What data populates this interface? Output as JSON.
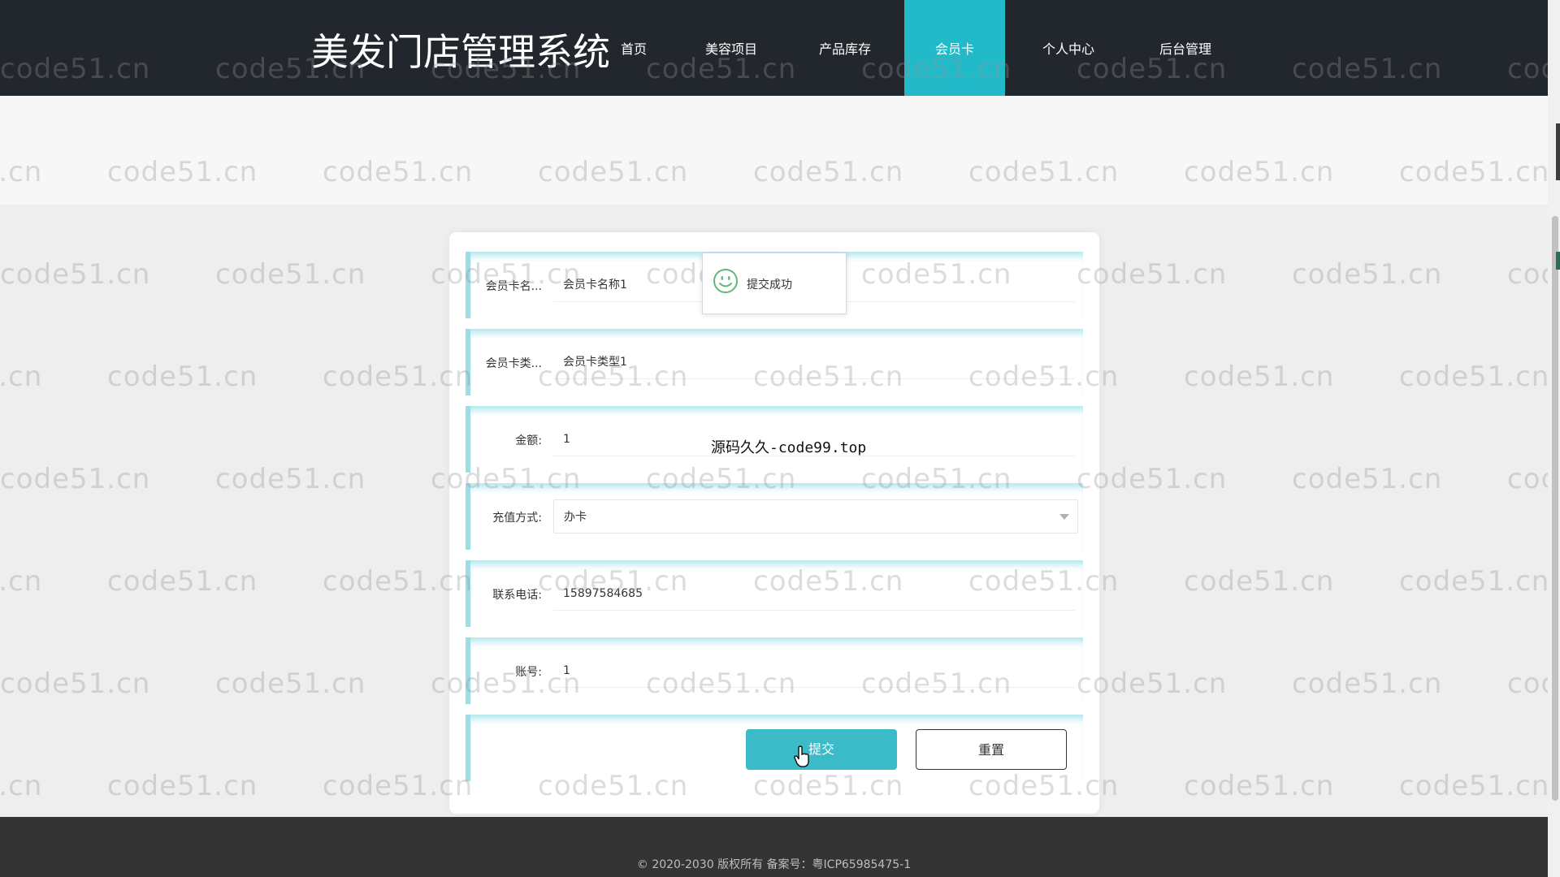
{
  "header": {
    "brand": "美发门店管理系统",
    "nav": [
      {
        "label": "首页",
        "active": false
      },
      {
        "label": "美容项目",
        "active": false
      },
      {
        "label": "产品库存",
        "active": false
      },
      {
        "label": "会员卡",
        "active": true
      },
      {
        "label": "个人中心",
        "active": false
      },
      {
        "label": "后台管理",
        "active": false
      }
    ]
  },
  "watermark": "code51.cn",
  "form": {
    "fields": [
      {
        "label": "会员卡名...",
        "value": "会员卡名称1"
      },
      {
        "label": "会员卡类...",
        "value": "会员卡类型1"
      },
      {
        "label": "金额:",
        "value": "1"
      },
      {
        "label": "充值方式:",
        "value": "办卡",
        "type": "select"
      },
      {
        "label": "联系电话:",
        "value": "15897584685"
      },
      {
        "label": "账号:",
        "value": "1"
      }
    ],
    "submit_label": "提交",
    "reset_label": "重置"
  },
  "toast": {
    "message": "提交成功",
    "icon": "smile-icon"
  },
  "source_note": "源码久久-code99.top",
  "footer": {
    "copyright": "© 2020-2030 版权所有 备案号：粤ICP65985475-1"
  },
  "colors": {
    "accent": "#22b9c8",
    "header_bg": "#22272d",
    "footer_bg": "#343434"
  }
}
